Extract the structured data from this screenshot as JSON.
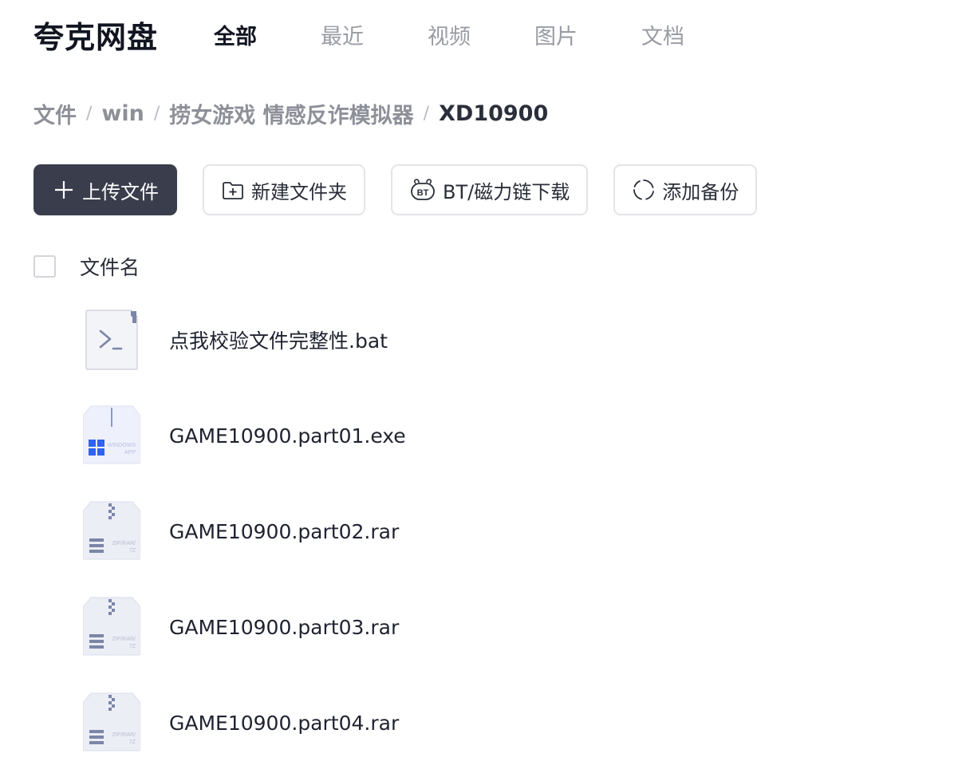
{
  "app": {
    "title": "夸克网盘"
  },
  "nav": {
    "items": [
      {
        "label": "全部",
        "active": true
      },
      {
        "label": "最近",
        "active": false
      },
      {
        "label": "视频",
        "active": false
      },
      {
        "label": "图片",
        "active": false
      },
      {
        "label": "文档",
        "active": false
      }
    ]
  },
  "breadcrumb": {
    "separator": "/",
    "items": [
      "文件",
      "win",
      "捞女游戏 情感反诈模拟器",
      "XD10900"
    ]
  },
  "toolbar": {
    "upload_label": "上传文件",
    "new_folder_label": "新建文件夹",
    "bt_label": "BT/磁力链下载",
    "backup_label": "添加备份",
    "bt_icon_text": "BT"
  },
  "list": {
    "header_label": "文件名",
    "files": [
      {
        "name": "点我校验文件完整性.bat",
        "icon": "terminal-file-icon"
      },
      {
        "name": "GAME10900.part01.exe",
        "icon": "windows-app-icon",
        "icon_text_top": "WINDOWS",
        "icon_text_bottom": "APP"
      },
      {
        "name": "GAME10900.part02.rar",
        "icon": "archive-file-icon",
        "icon_text_top": "ZIP/RAR/",
        "icon_text_bottom": "7Z"
      },
      {
        "name": "GAME10900.part03.rar",
        "icon": "archive-file-icon",
        "icon_text_top": "ZIP/RAR/",
        "icon_text_bottom": "7Z"
      },
      {
        "name": "GAME10900.part04.rar",
        "icon": "archive-file-icon",
        "icon_text_top": "ZIP/RAR/",
        "icon_text_bottom": "7Z"
      }
    ]
  },
  "colors": {
    "primary_button": "#393d4c",
    "active_nav": "#111520",
    "inactive_nav": "#9a9ca4",
    "windows_blue": "#2f63f0",
    "archive_slate": "#7b86a8"
  }
}
